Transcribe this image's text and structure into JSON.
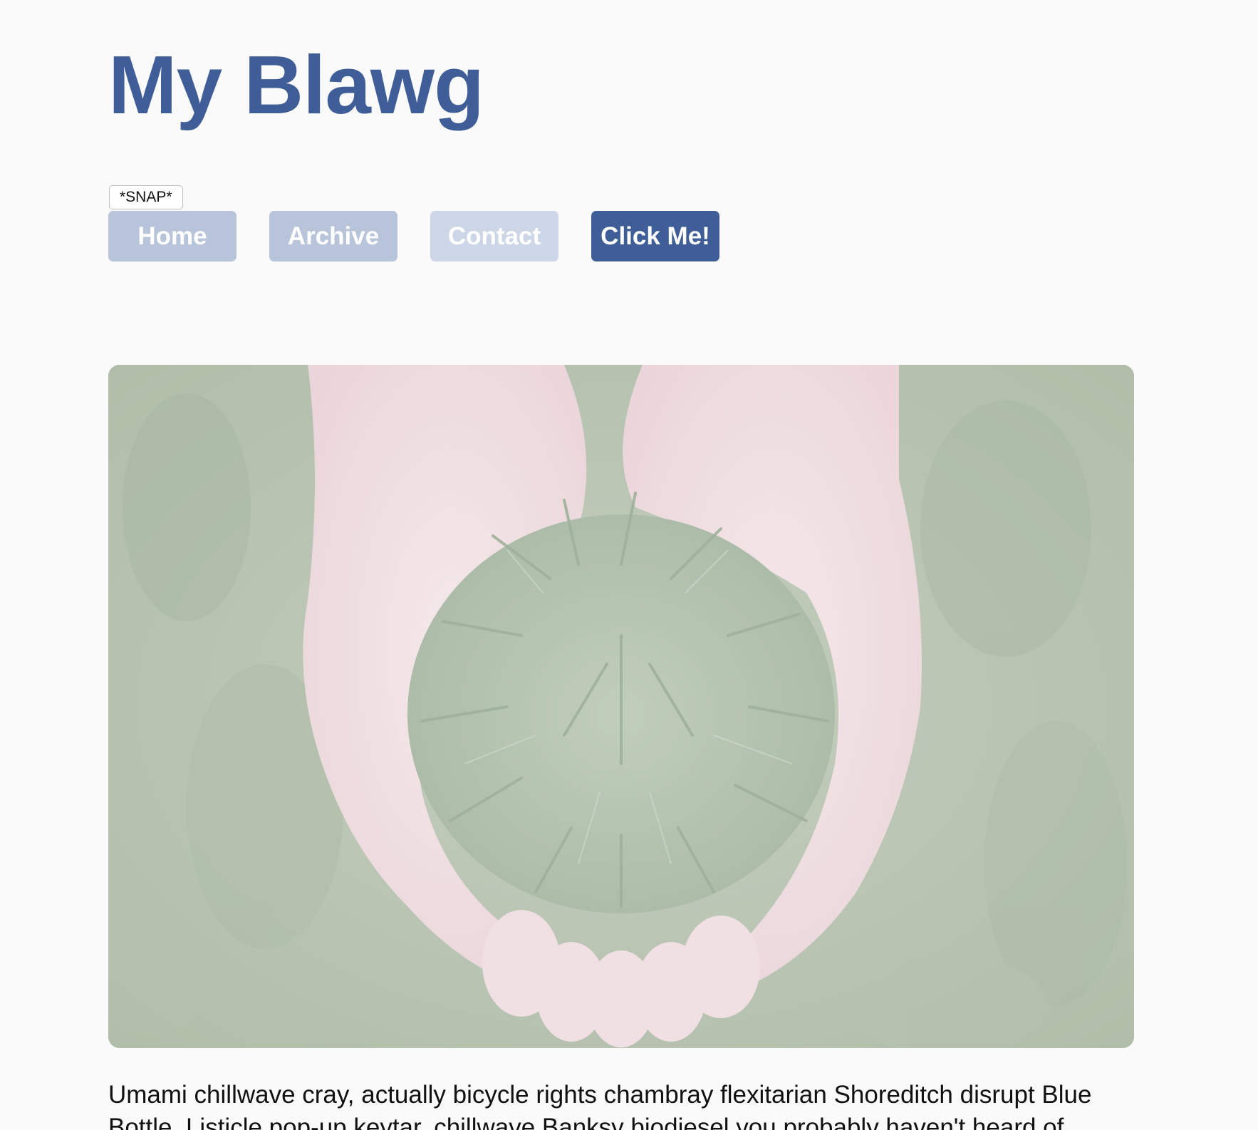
{
  "site": {
    "title": "My Blawg"
  },
  "tooltip": {
    "text": "*SNAP*"
  },
  "nav": {
    "home": "Home",
    "archive": "Archive",
    "contact": "Contact",
    "click_me": "Click Me!"
  },
  "hero": {
    "subject": "cupped hands holding green pine sprigs over grass",
    "icon": "photo"
  },
  "article": {
    "paragraph": "Umami chillwave cray, actually bicycle rights chambray flexitarian Shoreditch disrupt Blue Bottle. Listicle pop-up keytar, chillwave Banksy biodiesel you probably haven't heard of"
  },
  "colors": {
    "brand": "#3f5d97",
    "nav_inactive": "#b8c4da",
    "nav_faded": "#cdd6e6",
    "background": "#fafafa",
    "text": "#111111"
  }
}
